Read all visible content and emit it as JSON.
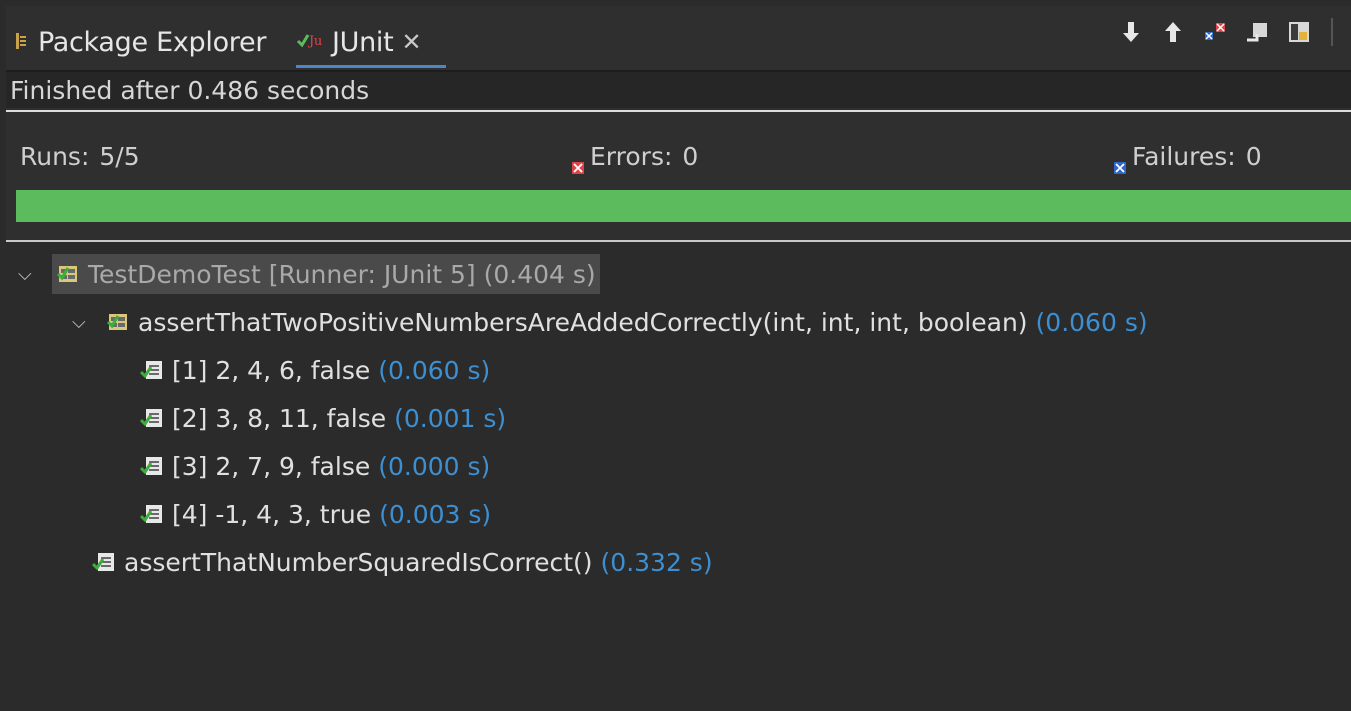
{
  "tabs": {
    "package_explorer": "Package Explorer",
    "junit": "JUnit",
    "close_symbol": "✕"
  },
  "toolbar": {
    "icons": [
      "next-failure-icon",
      "previous-failure-icon",
      "show-failures-only-icon",
      "scroll-lock-icon",
      "layout-icon"
    ]
  },
  "status": {
    "finished": "Finished after 0.486 seconds"
  },
  "counters": {
    "runs_label": "Runs:",
    "runs_value": "5/5",
    "errors_label": "Errors:",
    "errors_value": "0",
    "failures_label": "Failures:",
    "failures_value": "0"
  },
  "progress": {
    "fraction": 1.0,
    "color": "#5cbb5c"
  },
  "tree": {
    "root": {
      "label": "TestDemoTest [Runner: JUnit 5] (0.404 s)"
    },
    "method1": {
      "label": "assertThatTwoPositiveNumbersAreAddedCorrectly(int, int, int, boolean)",
      "time": "(0.060 s)"
    },
    "cases": [
      {
        "label": "[1] 2, 4, 6, false",
        "time": "(0.060 s)"
      },
      {
        "label": "[2] 3, 8, 11, false",
        "time": "(0.001 s)"
      },
      {
        "label": "[3] 2, 7, 9, false",
        "time": "(0.000 s)"
      },
      {
        "label": "[4] -1, 4, 3, true",
        "time": "(0.003 s)"
      }
    ],
    "method2": {
      "label": "assertThatNumberSquaredIsCorrect()",
      "time": "(0.332 s)"
    }
  },
  "colors": {
    "time": "#3d8fd1",
    "success": "#5cbb5c",
    "error": "#e0424a",
    "failure": "#2f67c9"
  }
}
